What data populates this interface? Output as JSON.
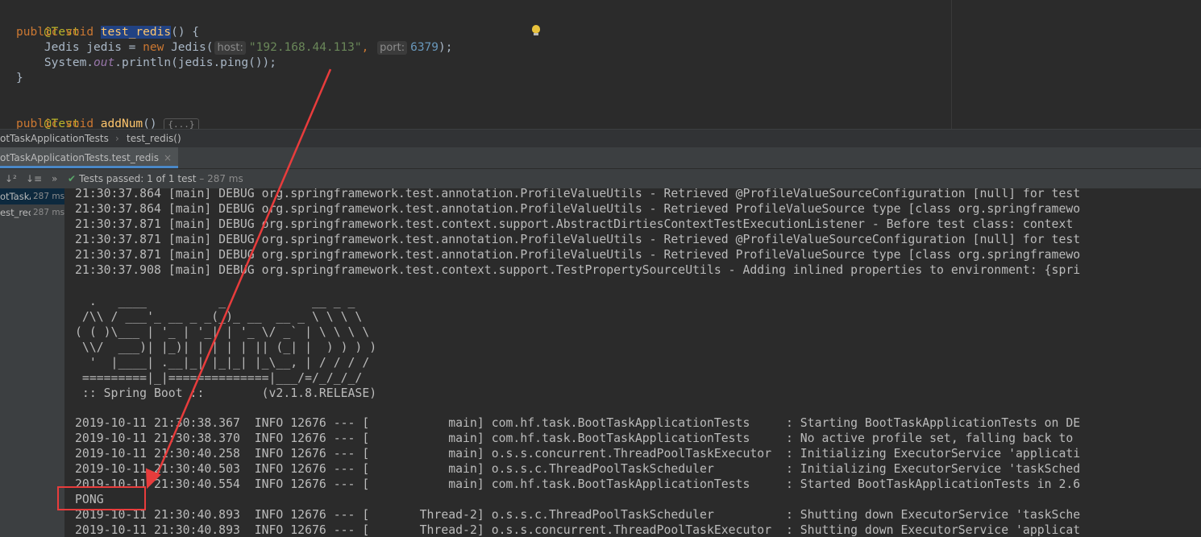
{
  "editor": {
    "annotation1": "@Test",
    "kw_public": "public",
    "kw_void": "void",
    "method1": "test_redis",
    "paren_open_brace": "() {",
    "line3_type": "Jedis jedis = ",
    "kw_new": "new",
    "line3_call": " Jedis(",
    "hint_host": "host:",
    "host_value": "\"192.168.44.113\"",
    "comma": ",",
    "hint_port": "port:",
    "port_value": "6379",
    "line3_end": ");",
    "line4_a": "System.",
    "line4_out": "out",
    "line4_b": ".println(jedis.ping());",
    "close_brace": "}",
    "annotation2": "@Test",
    "method2": "addNum",
    "method2_paren": "()",
    "fold_label": "{...}"
  },
  "breadcrumb": {
    "class_name": "otTaskApplicationTests",
    "separator": "›",
    "method": "test_redis()"
  },
  "run": {
    "tab_label": "otTaskApplicationTests.test_redis",
    "tab_close": "×",
    "sort_alpha_icon_text": "↓²",
    "sort_dur_icon_text": "↓≡",
    "expand_icon_text": "»",
    "status_prefix": "Tests passed: ",
    "status_count": "1",
    "status_of": " of 1 test",
    "status_time": " – 287 ms",
    "tree": [
      {
        "name": "otTaskA",
        "time": "287 ms"
      },
      {
        "name": "est_rec",
        "time": "287 ms"
      }
    ]
  },
  "console": {
    "debug_lines": [
      "21:30:37.864 [main] DEBUG org.springframework.test.annotation.ProfileValueUtils - Retrieved @ProfileValueSourceConfiguration [null] for test",
      "21:30:37.864 [main] DEBUG org.springframework.test.annotation.ProfileValueUtils - Retrieved ProfileValueSource type [class org.springframewo",
      "21:30:37.871 [main] DEBUG org.springframework.test.context.support.AbstractDirtiesContextTestExecutionListener - Before test class: context",
      "21:30:37.871 [main] DEBUG org.springframework.test.annotation.ProfileValueUtils - Retrieved @ProfileValueSourceConfiguration [null] for test",
      "21:30:37.871 [main] DEBUG org.springframework.test.annotation.ProfileValueUtils - Retrieved ProfileValueSource type [class org.springframewo",
      "21:30:37.908 [main] DEBUG org.springframework.test.context.support.TestPropertySourceUtils - Adding inlined properties to environment: {spri"
    ],
    "banner": [
      "  .   ____          _            __ _ _",
      " /\\\\ / ___'_ __ _ _(_)_ __  __ _ \\ \\ \\ \\",
      "( ( )\\___ | '_ | '_| | '_ \\/ _` | \\ \\ \\ \\",
      " \\\\/  ___)| |_)| | | | | || (_| |  ) ) ) )",
      "  '  |____| .__|_| |_|_| |_\\__, | / / / /",
      " =========|_|==============|___/=/_/_/_/",
      " :: Spring Boot ::        (v2.1.8.RELEASE)"
    ],
    "info_lines": [
      "2019-10-11 21:30:38.367  INFO 12676 --- [           main] com.hf.task.BootTaskApplicationTests     : Starting BootTaskApplicationTests on DE",
      "2019-10-11 21:30:38.370  INFO 12676 --- [           main] com.hf.task.BootTaskApplicationTests     : No active profile set, falling back to",
      "2019-10-11 21:30:40.258  INFO 12676 --- [           main] o.s.s.concurrent.ThreadPoolTaskExecutor  : Initializing ExecutorService 'applicati",
      "2019-10-11 21:30:40.503  INFO 12676 --- [           main] o.s.s.c.ThreadPoolTaskScheduler          : Initializing ExecutorService 'taskSched",
      "2019-10-11 21:30:40.554  INFO 12676 --- [           main] com.hf.task.BootTaskApplicationTests     : Started BootTaskApplicationTests in 2.6"
    ],
    "pong": "PONG",
    "shutdown_lines": [
      "2019-10-11 21:30:40.893  INFO 12676 --- [       Thread-2] o.s.s.c.ThreadPoolTaskScheduler          : Shutting down ExecutorService 'taskSche",
      "2019-10-11 21:30:40.893  INFO 12676 --- [       Thread-2] o.s.s.concurrent.ThreadPoolTaskExecutor  : Shutting down ExecutorService 'applicat"
    ]
  },
  "colors": {
    "annotation_arrow": "#e83c3c",
    "test_pass_green": "#59a869"
  }
}
